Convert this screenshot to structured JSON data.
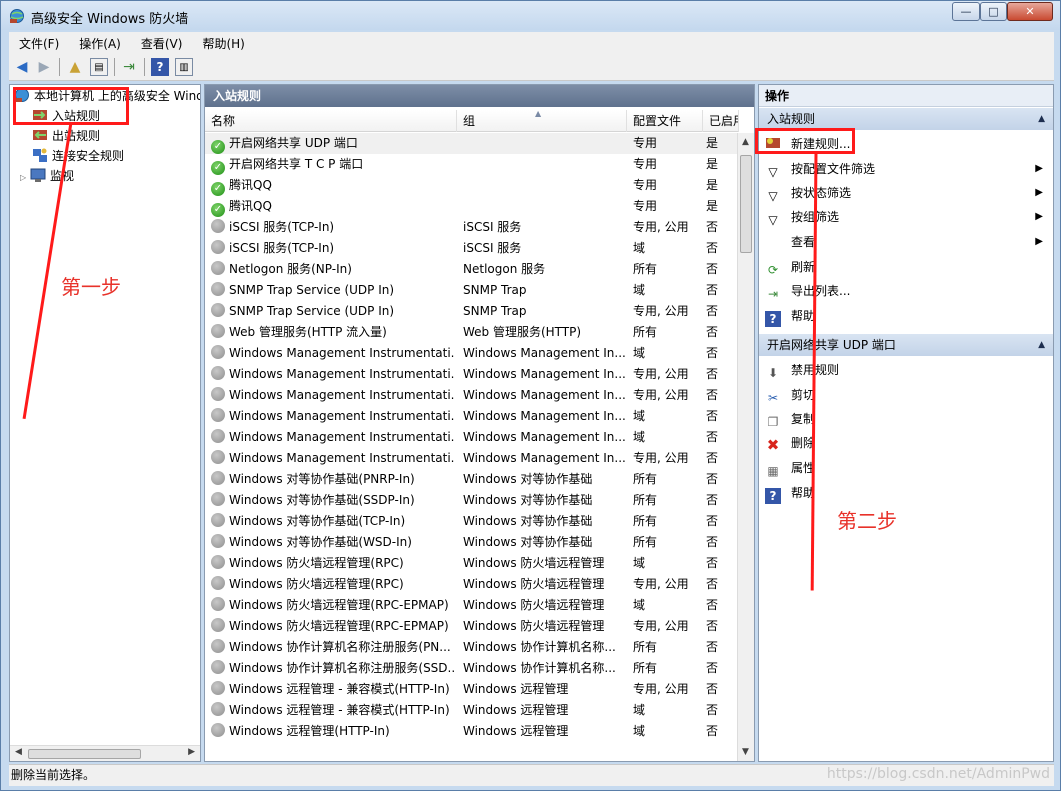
{
  "window": {
    "title": "高级安全 Windows 防火墙",
    "min_glyph": "—",
    "max_glyph": "□",
    "close_glyph": "✕"
  },
  "menu": [
    "文件(F)",
    "操作(A)",
    "查看(V)",
    "帮助(H)"
  ],
  "tree": {
    "root": "本地计算机 上的高级安全 Windows",
    "items": [
      "入站规则",
      "出站规则",
      "连接安全规则",
      "监视"
    ]
  },
  "main": {
    "header": "入站规则",
    "columns": [
      "名称",
      "组",
      "配置文件",
      "已启用"
    ],
    "rows": [
      {
        "name": "开启网络共享 UDP 端口",
        "group": "",
        "profile": "专用",
        "enabled": "是",
        "status": "on"
      },
      {
        "name": "开启网络共享 T C P 端口",
        "group": "",
        "profile": "专用",
        "enabled": "是",
        "status": "on"
      },
      {
        "name": "腾讯QQ",
        "group": "",
        "profile": "专用",
        "enabled": "是",
        "status": "on"
      },
      {
        "name": "腾讯QQ",
        "group": "",
        "profile": "专用",
        "enabled": "是",
        "status": "on"
      },
      {
        "name": "iSCSI 服务(TCP-In)",
        "group": "iSCSI 服务",
        "profile": "专用, 公用",
        "enabled": "否",
        "status": "off"
      },
      {
        "name": "iSCSI 服务(TCP-In)",
        "group": "iSCSI 服务",
        "profile": "域",
        "enabled": "否",
        "status": "off"
      },
      {
        "name": "Netlogon 服务(NP-In)",
        "group": "Netlogon 服务",
        "profile": "所有",
        "enabled": "否",
        "status": "off"
      },
      {
        "name": "SNMP Trap Service (UDP In)",
        "group": "SNMP Trap",
        "profile": "域",
        "enabled": "否",
        "status": "off"
      },
      {
        "name": "SNMP Trap Service (UDP In)",
        "group": "SNMP Trap",
        "profile": "专用, 公用",
        "enabled": "否",
        "status": "off"
      },
      {
        "name": "Web 管理服务(HTTP 流入量)",
        "group": "Web 管理服务(HTTP)",
        "profile": "所有",
        "enabled": "否",
        "status": "off"
      },
      {
        "name": "Windows Management Instrumentati...",
        "group": "Windows Management In...",
        "profile": "域",
        "enabled": "否",
        "status": "off"
      },
      {
        "name": "Windows Management Instrumentati...",
        "group": "Windows Management In...",
        "profile": "专用, 公用",
        "enabled": "否",
        "status": "off"
      },
      {
        "name": "Windows Management Instrumentati...",
        "group": "Windows Management In...",
        "profile": "专用, 公用",
        "enabled": "否",
        "status": "off"
      },
      {
        "name": "Windows Management Instrumentati...",
        "group": "Windows Management In...",
        "profile": "域",
        "enabled": "否",
        "status": "off"
      },
      {
        "name": "Windows Management Instrumentati...",
        "group": "Windows Management In...",
        "profile": "域",
        "enabled": "否",
        "status": "off"
      },
      {
        "name": "Windows Management Instrumentati...",
        "group": "Windows Management In...",
        "profile": "专用, 公用",
        "enabled": "否",
        "status": "off"
      },
      {
        "name": "Windows 对等协作基础(PNRP-In)",
        "group": "Windows 对等协作基础",
        "profile": "所有",
        "enabled": "否",
        "status": "off"
      },
      {
        "name": "Windows 对等协作基础(SSDP-In)",
        "group": "Windows 对等协作基础",
        "profile": "所有",
        "enabled": "否",
        "status": "off"
      },
      {
        "name": "Windows 对等协作基础(TCP-In)",
        "group": "Windows 对等协作基础",
        "profile": "所有",
        "enabled": "否",
        "status": "off"
      },
      {
        "name": "Windows 对等协作基础(WSD-In)",
        "group": "Windows 对等协作基础",
        "profile": "所有",
        "enabled": "否",
        "status": "off"
      },
      {
        "name": "Windows 防火墙远程管理(RPC)",
        "group": "Windows 防火墙远程管理",
        "profile": "域",
        "enabled": "否",
        "status": "off"
      },
      {
        "name": "Windows 防火墙远程管理(RPC)",
        "group": "Windows 防火墙远程管理",
        "profile": "专用, 公用",
        "enabled": "否",
        "status": "off"
      },
      {
        "name": "Windows 防火墙远程管理(RPC-EPMAP)",
        "group": "Windows 防火墙远程管理",
        "profile": "域",
        "enabled": "否",
        "status": "off"
      },
      {
        "name": "Windows 防火墙远程管理(RPC-EPMAP)",
        "group": "Windows 防火墙远程管理",
        "profile": "专用, 公用",
        "enabled": "否",
        "status": "off"
      },
      {
        "name": "Windows 协作计算机名称注册服务(PN...",
        "group": "Windows 协作计算机名称...",
        "profile": "所有",
        "enabled": "否",
        "status": "off"
      },
      {
        "name": "Windows 协作计算机名称注册服务(SSD...",
        "group": "Windows 协作计算机名称...",
        "profile": "所有",
        "enabled": "否",
        "status": "off"
      },
      {
        "name": "Windows 远程管理 - 兼容模式(HTTP-In)",
        "group": "Windows 远程管理",
        "profile": "专用, 公用",
        "enabled": "否",
        "status": "off"
      },
      {
        "name": "Windows 远程管理 - 兼容模式(HTTP-In)",
        "group": "Windows 远程管理",
        "profile": "域",
        "enabled": "否",
        "status": "off"
      },
      {
        "name": "Windows 远程管理(HTTP-In)",
        "group": "Windows 远程管理",
        "profile": "域",
        "enabled": "否",
        "status": "off"
      }
    ]
  },
  "actions": {
    "header": "操作",
    "section1": {
      "title": "入站规则",
      "items": [
        "新建规则...",
        "按配置文件筛选",
        "按状态筛选",
        "按组筛选",
        "查看",
        "刷新",
        "导出列表...",
        "帮助"
      ]
    },
    "section2": {
      "title": "开启网络共享 UDP 端口",
      "items": [
        "禁用规则",
        "剪切",
        "复制",
        "删除",
        "属性",
        "帮助"
      ]
    }
  },
  "statusbar": "删除当前选择。",
  "watermark": "https://blog.csdn.net/AdminPwd",
  "annotations": {
    "step1": "第一步",
    "step2": "第二步"
  },
  "colors": {
    "annotation_red": "#ff1a1a",
    "enabled_green": "#1f8f16",
    "header_blue": "#5f718d"
  }
}
